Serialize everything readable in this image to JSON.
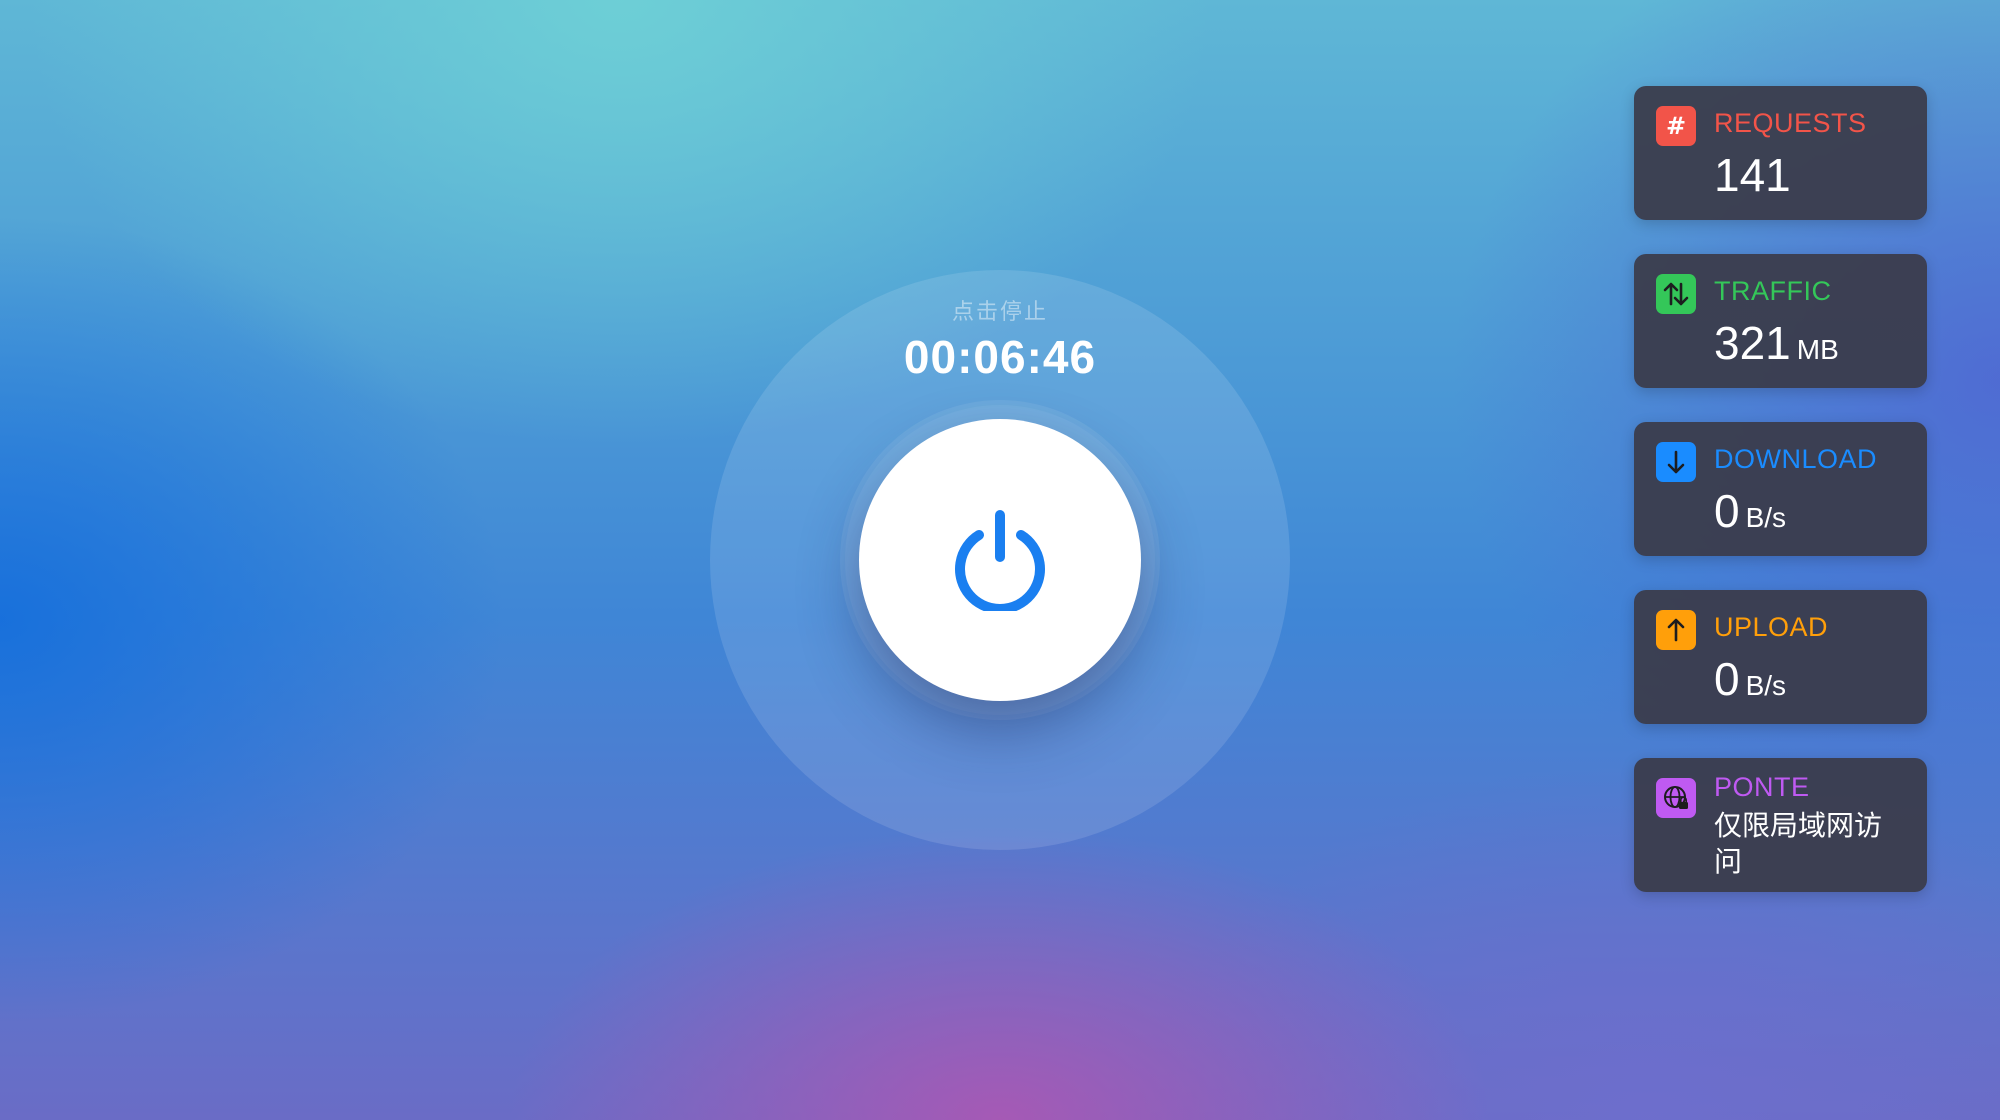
{
  "control": {
    "hint": "点击停止",
    "timer": "00:06:46",
    "power_icon": "power-icon",
    "accent_color": "#1a7ff0"
  },
  "stats": {
    "requests": {
      "icon": "hash-icon",
      "icon_glyph": "#",
      "label": "REQUESTS",
      "value": "141",
      "color": "#f25449"
    },
    "traffic": {
      "icon": "arrows-up-down-icon",
      "label": "TRAFFIC",
      "value": "321",
      "unit": "MB",
      "color": "#34c759"
    },
    "download": {
      "icon": "arrow-down-icon",
      "label": "DOWNLOAD",
      "value": "0",
      "unit": "B/s",
      "color": "#1a8cff"
    },
    "upload": {
      "icon": "arrow-up-icon",
      "label": "UPLOAD",
      "value": "0",
      "unit": "B/s",
      "color": "#ff9f0a"
    },
    "ponte": {
      "icon": "globe-lock-icon",
      "label": "PONTE",
      "value": "仅限局域网访问",
      "color": "#bf5af2"
    }
  }
}
